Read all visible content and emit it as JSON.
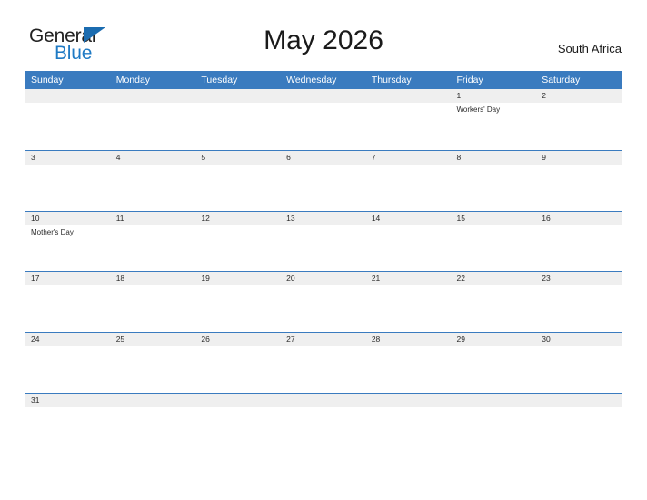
{
  "brand": {
    "name_part1": "General",
    "name_part2": "Blue",
    "flag_icon": "flag-triangle-icon",
    "color_primary": "#1f7ac4",
    "color_dark": "#222222"
  },
  "header": {
    "title": "May 2026",
    "country": "South Africa"
  },
  "theme": {
    "header_blue": "#3a7bbf",
    "number_band_gray": "#efefef",
    "rule_blue": "#3a7bbf",
    "text_dark": "#2b2b2b",
    "background": "#ffffff"
  },
  "calendar": {
    "month": "May",
    "year": "2026",
    "weekday_headers": [
      "Sunday",
      "Monday",
      "Tuesday",
      "Wednesday",
      "Thursday",
      "Friday",
      "Saturday"
    ],
    "weeks": [
      {
        "days": [
          {
            "number": "",
            "event": ""
          },
          {
            "number": "",
            "event": ""
          },
          {
            "number": "",
            "event": ""
          },
          {
            "number": "",
            "event": ""
          },
          {
            "number": "",
            "event": ""
          },
          {
            "number": "1",
            "event": "Workers' Day"
          },
          {
            "number": "2",
            "event": ""
          }
        ]
      },
      {
        "days": [
          {
            "number": "3",
            "event": ""
          },
          {
            "number": "4",
            "event": ""
          },
          {
            "number": "5",
            "event": ""
          },
          {
            "number": "6",
            "event": ""
          },
          {
            "number": "7",
            "event": ""
          },
          {
            "number": "8",
            "event": ""
          },
          {
            "number": "9",
            "event": ""
          }
        ]
      },
      {
        "days": [
          {
            "number": "10",
            "event": "Mother's Day"
          },
          {
            "number": "11",
            "event": ""
          },
          {
            "number": "12",
            "event": ""
          },
          {
            "number": "13",
            "event": ""
          },
          {
            "number": "14",
            "event": ""
          },
          {
            "number": "15",
            "event": ""
          },
          {
            "number": "16",
            "event": ""
          }
        ]
      },
      {
        "days": [
          {
            "number": "17",
            "event": ""
          },
          {
            "number": "18",
            "event": ""
          },
          {
            "number": "19",
            "event": ""
          },
          {
            "number": "20",
            "event": ""
          },
          {
            "number": "21",
            "event": ""
          },
          {
            "number": "22",
            "event": ""
          },
          {
            "number": "23",
            "event": ""
          }
        ]
      },
      {
        "days": [
          {
            "number": "24",
            "event": ""
          },
          {
            "number": "25",
            "event": ""
          },
          {
            "number": "26",
            "event": ""
          },
          {
            "number": "27",
            "event": ""
          },
          {
            "number": "28",
            "event": ""
          },
          {
            "number": "29",
            "event": ""
          },
          {
            "number": "30",
            "event": ""
          }
        ]
      },
      {
        "days": [
          {
            "number": "31",
            "event": ""
          },
          {
            "number": "",
            "event": ""
          },
          {
            "number": "",
            "event": ""
          },
          {
            "number": "",
            "event": ""
          },
          {
            "number": "",
            "event": ""
          },
          {
            "number": "",
            "event": ""
          },
          {
            "number": "",
            "event": ""
          }
        ]
      }
    ]
  }
}
